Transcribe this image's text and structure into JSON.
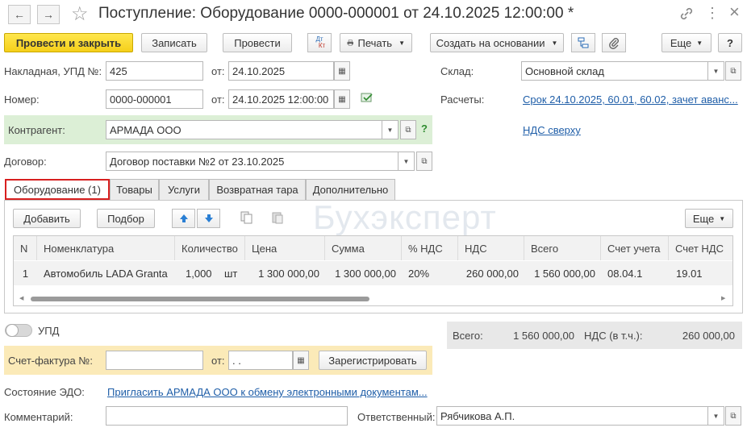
{
  "window": {
    "title": "Поступление: Оборудование 0000-000001 от 24.10.2025 12:00:00 *",
    "nav_back": "←",
    "nav_forward": "→",
    "star": "☆",
    "link_icon": "🔗",
    "more_icon": "⋮",
    "close_icon": "×"
  },
  "toolbar": {
    "post_close": "Провести и закрыть",
    "save": "Записать",
    "post": "Провести",
    "dtkt_top": "Дт",
    "dtkt_bottom": "Кт",
    "print": "Печать",
    "create_based": "Создать на основании",
    "more": "Еще",
    "help": "?"
  },
  "form": {
    "invoice_label": "Накладная, УПД №:",
    "invoice_value": "425",
    "from_label": "от:",
    "invoice_date": "24.10.2025",
    "number_label": "Номер:",
    "number_value": "0000-000001",
    "number_date": "24.10.2025 12:00:00",
    "warehouse_label": "Склад:",
    "warehouse_value": "Основной склад",
    "settlements_label": "Расчеты:",
    "settlements_link": "Срок 24.10.2025, 60.01, 60.02, зачет аванс...",
    "counterparty_label": "Контрагент:",
    "counterparty_value": "АРМАДА ООО",
    "counterparty_help": "?",
    "vat_link": "НДС сверху",
    "contract_label": "Договор:",
    "contract_value": "Договор поставки №2 от 23.10.2025"
  },
  "tabs": [
    {
      "label": "Оборудование (1)"
    },
    {
      "label": "Товары"
    },
    {
      "label": "Услуги"
    },
    {
      "label": "Возвратная тара"
    },
    {
      "label": "Дополнительно"
    }
  ],
  "table_toolbar": {
    "add": "Добавить",
    "select": "Подбор",
    "more": "Еще"
  },
  "watermark": "Бухэксперт",
  "table": {
    "columns": [
      "N",
      "Номенклатура",
      "Количество",
      "Цена",
      "Сумма",
      "% НДС",
      "НДС",
      "Всего",
      "Счет учета",
      "Счет НДС"
    ],
    "rows": [
      {
        "n": "1",
        "item": "Автомобиль LADA Granta",
        "qty": "1,000",
        "unit": "шт",
        "price": "1 300 000,00",
        "sum": "1 300 000,00",
        "vat_rate": "20%",
        "vat": "260 000,00",
        "total": "1 560 000,00",
        "account": "08.04.1",
        "vat_account": "19.01"
      }
    ]
  },
  "upd_toggle_label": "УПД",
  "totals": {
    "total_label": "Всего:",
    "total_value": "1 560 000,00",
    "vat_label": "НДС (в т.ч.):",
    "vat_value": "260 000,00"
  },
  "invoice_bar": {
    "label": "Счет-фактура №:",
    "number_value": "",
    "from_label": "от:",
    "date_value": " .  .",
    "register": "Зарегистрировать"
  },
  "edo": {
    "label": "Состояние ЭДО:",
    "link": "Пригласить АРМАДА ООО к обмену электронными документам..."
  },
  "comment": {
    "label": "Комментарий:",
    "value": "",
    "responsible_label": "Ответственный:",
    "responsible_value": "Рябчикова А.П."
  }
}
